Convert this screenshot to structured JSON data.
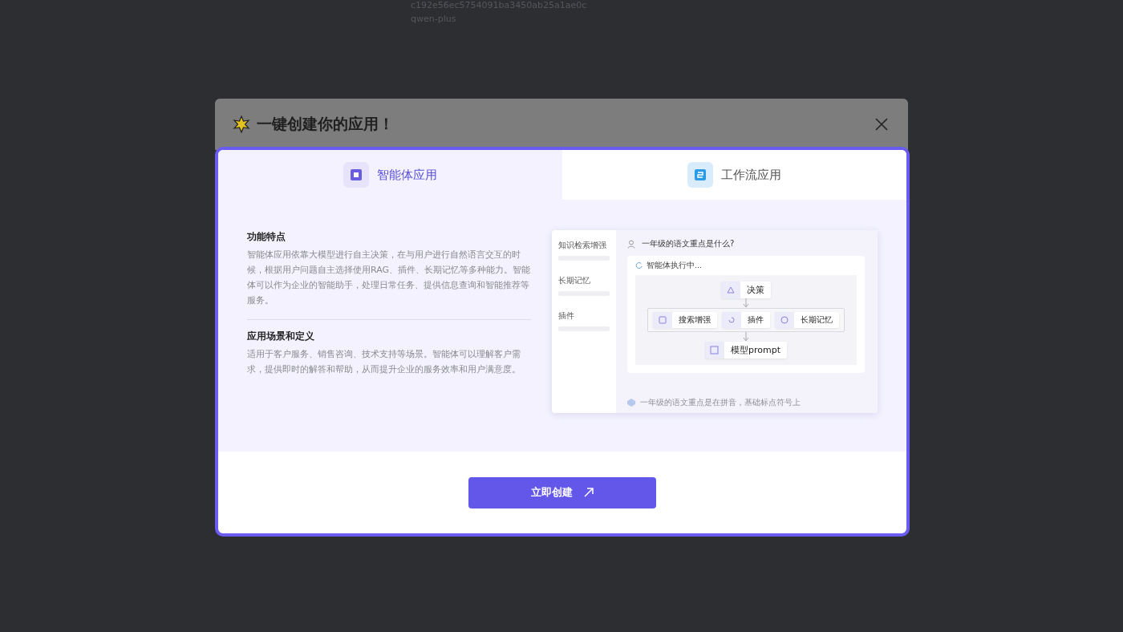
{
  "background": {
    "app_id": "c192e56ec5754091ba3450ab25a1ae0c",
    "model": "qwen-plus"
  },
  "dialog": {
    "title": "一键创建你的应用！"
  },
  "tabs": [
    {
      "label": "智能体应用",
      "selected": true,
      "kind": "agent"
    },
    {
      "label": "工作流应用",
      "selected": false,
      "kind": "workflow"
    }
  ],
  "sections": [
    {
      "heading": "功能特点",
      "body": "智能体应用依靠大模型进行自主决策，在与用户进行自然语言交互的时候，根据用户问题自主选择使用RAG、插件、长期记忆等多种能力。智能体可以作为企业的智能助手，处理日常任务、提供信息查询和智能推荐等服务。"
    },
    {
      "heading": "应用场景和定义",
      "body": "适用于客户服务、销售咨询、技术支持等场景。智能体可以理解客户需求，提供即时的解答和帮助，从而提升企业的服务效率和用户满意度。"
    }
  ],
  "preview": {
    "sidebar": [
      "知识检索增强",
      "长期记忆",
      "插件"
    ],
    "question": "一年级的语文重点是什么?",
    "status": "智能体执行中...",
    "decision": "决策",
    "tools": [
      {
        "label": "搜索增强",
        "kind": "search"
      },
      {
        "label": "插件",
        "kind": "plugin"
      },
      {
        "label": "长期记忆",
        "kind": "memory"
      }
    ],
    "model": "模型prompt",
    "answer": "一年级的语文重点是在拼音，基础标点符号上"
  },
  "create_button": "立即创建"
}
